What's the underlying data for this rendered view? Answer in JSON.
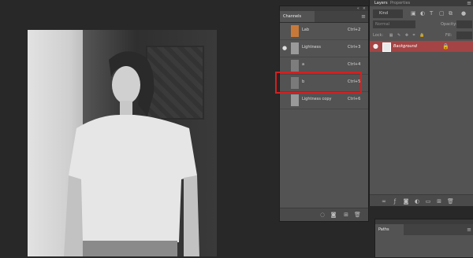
{
  "channels": {
    "title": "Channels",
    "menu_icon": "panel-menu-icon",
    "rows": [
      {
        "name": "Lab",
        "shortcut": "Ctrl+2",
        "visible": false
      },
      {
        "name": "Lightness",
        "shortcut": "Ctrl+3",
        "visible": true
      },
      {
        "name": "a",
        "shortcut": "Ctrl+4",
        "visible": false
      },
      {
        "name": "b",
        "shortcut": "Ctrl+5",
        "visible": false
      },
      {
        "name": "Lightness copy",
        "shortcut": "Ctrl+6",
        "visible": false
      }
    ],
    "highlight_color": "#d32020"
  },
  "layers": {
    "tabs": [
      "Layers",
      "Properties"
    ],
    "kind_label": "Kind",
    "blend_mode": "Normal",
    "opacity_label": "Opacity:",
    "lock_label": "Lock:",
    "fill_label": "Fill:",
    "layer": {
      "name": "Background",
      "color": "#a44444"
    }
  },
  "paths": {
    "title": "Paths"
  }
}
